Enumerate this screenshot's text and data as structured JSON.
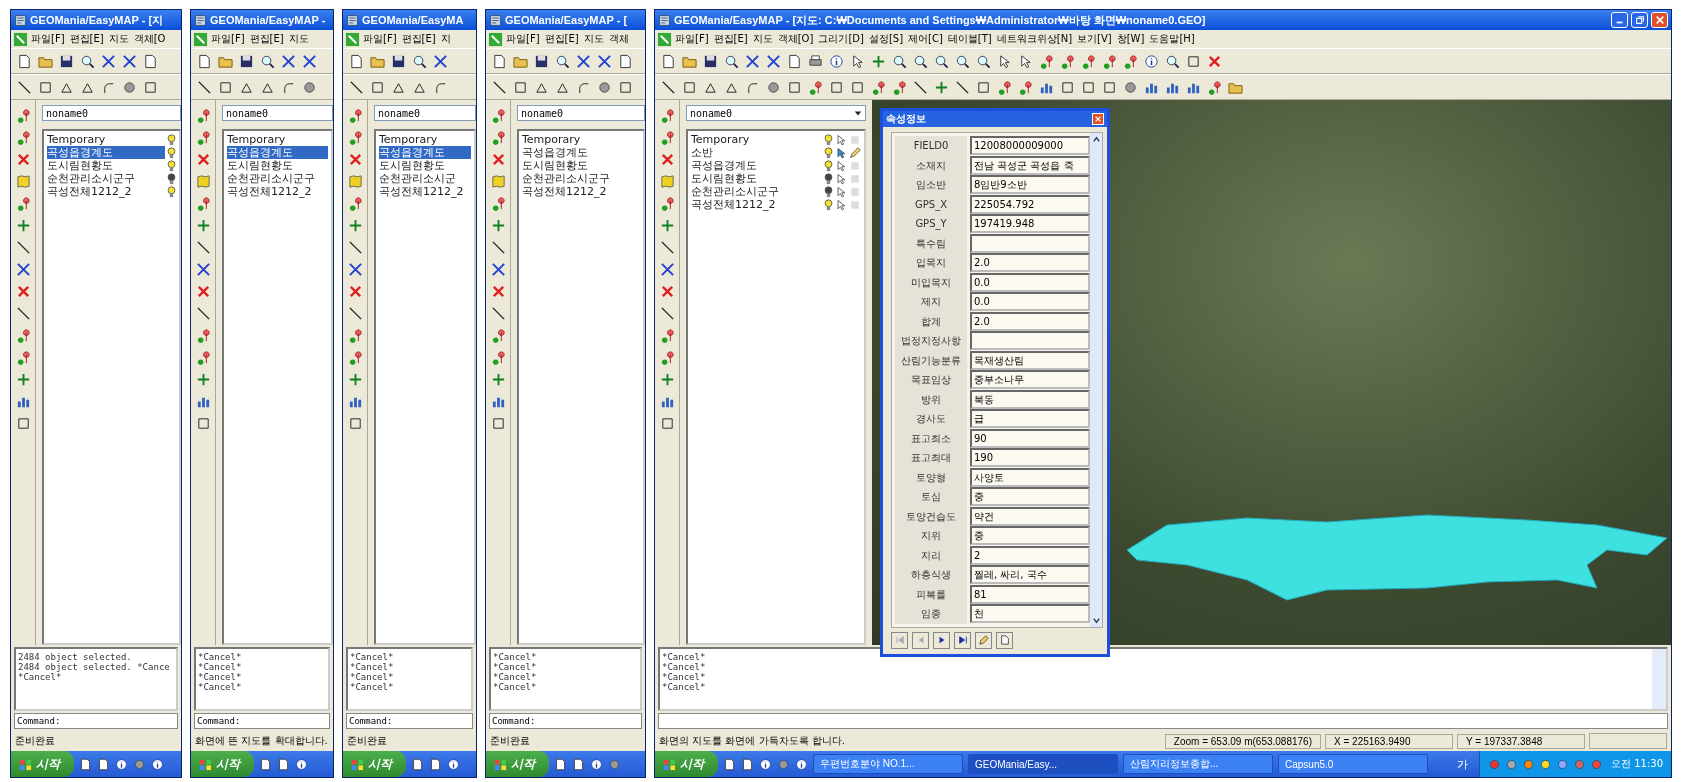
{
  "windows": [
    {
      "title": "GEOMania/EasyMAP - [지",
      "menu": [
        "파일[F]",
        "편집[E]",
        "지도",
        "객체[O"
      ],
      "map_name": "noname0",
      "layers": [
        {
          "name": "Temporary",
          "selected": false,
          "visible": true
        },
        {
          "name": "곡성읍경계도",
          "selected": true,
          "visible": true
        },
        {
          "name": "도시림현황도",
          "selected": false,
          "visible": true
        },
        {
          "name": "순천관리소시군구",
          "selected": false,
          "visible": false
        },
        {
          "name": "곡성전체1212_2",
          "selected": false,
          "visible": true
        }
      ],
      "log": [
        "2484 object selected.",
        "2484 object selected. *Cance",
        "*Cancel*"
      ],
      "command": "Command:",
      "status": "준비완료",
      "start": "시작"
    },
    {
      "title": "GEOMania/EasyMAP -",
      "menu": [
        "파일[F]",
        "편집[E]",
        "지도"
      ],
      "map_name": "noname0",
      "layers": [
        {
          "name": "Temporary",
          "selected": false
        },
        {
          "name": "곡성읍경계도",
          "selected": true
        },
        {
          "name": "도시림현황도",
          "selected": false
        },
        {
          "name": "순천관리소시군구",
          "selected": false
        },
        {
          "name": "곡성전체1212_2",
          "selected": false
        }
      ],
      "log": [
        "*Cancel*",
        "*Cancel*",
        "*Cancel*",
        "*Cancel*"
      ],
      "command": "Command:",
      "status": "화면에 뜬 지도를 확대합니다.",
      "start": "시작"
    },
    {
      "title": "GEOMania/EasyMA",
      "menu": [
        "파일[F]",
        "편집[E]",
        "지"
      ],
      "map_name": "noname0",
      "layers": [
        {
          "name": "Temporary",
          "selected": false
        },
        {
          "name": "곡성읍경계도",
          "selected": true
        },
        {
          "name": "도시림현황도",
          "selected": false
        },
        {
          "name": "순천관리소시군",
          "selected": false
        },
        {
          "name": "곡성전체1212_2",
          "selected": false
        }
      ],
      "log": [
        "*Cancel*",
        "*Cancel*",
        "*Cancel*",
        "*Cancel*"
      ],
      "command": "Command:",
      "status": "준비완료",
      "start": "시작"
    },
    {
      "title": "GEOMania/EasyMAP - [",
      "menu": [
        "파일[F]",
        "편집[E]",
        "지도",
        "객체"
      ],
      "map_name": "noname0",
      "layers": [
        {
          "name": "Temporary",
          "selected": false
        },
        {
          "name": "곡성읍경계도",
          "selected": false
        },
        {
          "name": "도시림현황도",
          "selected": false
        },
        {
          "name": "순천관리소시군구",
          "selected": false
        },
        {
          "name": "곡성전체1212_2",
          "selected": false
        }
      ],
      "log": [
        "*Cancel*",
        "*Cancel*",
        "*Cancel*",
        "*Cancel*"
      ],
      "command": "Command:",
      "status": "준비완료",
      "start": "시작"
    },
    {
      "title": "GEOMania/EasyMAP - [지도: C:₩Documents and Settings₩Administrator₩바탕 화면₩noname0.GEO]",
      "menu": [
        "파일[F]",
        "편집[E]",
        "지도",
        "객체[O]",
        "그리기[D]",
        "설정[S]",
        "제어[C]",
        "테이블[T]",
        "네트워크위상[N]",
        "보기[V]",
        "창[W]",
        "도움말[H]"
      ],
      "map_name": "noname0",
      "layers": [
        {
          "name": "Temporary",
          "selected": false,
          "visible": true,
          "editing": false
        },
        {
          "name": "소반",
          "selected": false,
          "visible": true,
          "editing": true
        },
        {
          "name": "곡성읍경계도",
          "selected": false,
          "visible": true,
          "editing": false
        },
        {
          "name": "도시림현황도",
          "selected": false,
          "visible": false,
          "editing": false
        },
        {
          "name": "순천관리소시군구",
          "selected": false,
          "visible": false,
          "editing": false
        },
        {
          "name": "곡성전체1212_2",
          "selected": false,
          "visible": true,
          "editing": false
        }
      ],
      "attribute_dialog": {
        "title": "속성정보",
        "rows": [
          {
            "label": "FIELD0",
            "value": "12008000009000"
          },
          {
            "label": "소재지",
            "value": "전남 곡성군 곡성읍 죽"
          },
          {
            "label": "임소반",
            "value": "8임반9소반"
          },
          {
            "label": "GPS_X",
            "value": "225054.792"
          },
          {
            "label": "GPS_Y",
            "value": "197419.948"
          },
          {
            "label": "특수림",
            "value": ""
          },
          {
            "label": "입목지",
            "value": "2.0"
          },
          {
            "label": "미입목지",
            "value": "0.0"
          },
          {
            "label": "제지",
            "value": "0.0"
          },
          {
            "label": "합계",
            "value": "2.0"
          },
          {
            "label": "법정지정사항",
            "value": ""
          },
          {
            "label": "산림기능분류",
            "value": "목재생산림"
          },
          {
            "label": "목표임상",
            "value": "중부소나무"
          },
          {
            "label": "방위",
            "value": "북동"
          },
          {
            "label": "경사도",
            "value": "급"
          },
          {
            "label": "표고최소",
            "value": "90"
          },
          {
            "label": "표고최대",
            "value": "190"
          },
          {
            "label": "토양형",
            "value": "사양토"
          },
          {
            "label": "토심",
            "value": "중"
          },
          {
            "label": "토양건습도",
            "value": "약건"
          },
          {
            "label": "지위",
            "value": "중"
          },
          {
            "label": "지리",
            "value": "2"
          },
          {
            "label": "하층식생",
            "value": "찔레, 싸리, 국수"
          },
          {
            "label": "피복률",
            "value": "81"
          },
          {
            "label": "임종",
            "value": "천"
          }
        ]
      },
      "log": [
        "*Cancel*",
        "*Cancel*",
        "*Cancel*",
        "*Cancel*"
      ],
      "status": "화면의 지도를 화면에 가득차도록 합니다.",
      "status_cells": [
        "Zoom = 653.09   m(653.088176)",
        "X = 225163.9490",
        "Y = 197337.3848"
      ],
      "start": "시작",
      "tasks": [
        {
          "label": "우편번호분야 NO.1...",
          "selected": false
        },
        {
          "label": "GEOMania/Easy...",
          "selected": true
        },
        {
          "label": "산림지리정보종합...",
          "selected": false
        },
        {
          "label": "Capsun5.0",
          "selected": false
        }
      ],
      "input_language": "가",
      "clock": "오전 11:30"
    }
  ]
}
